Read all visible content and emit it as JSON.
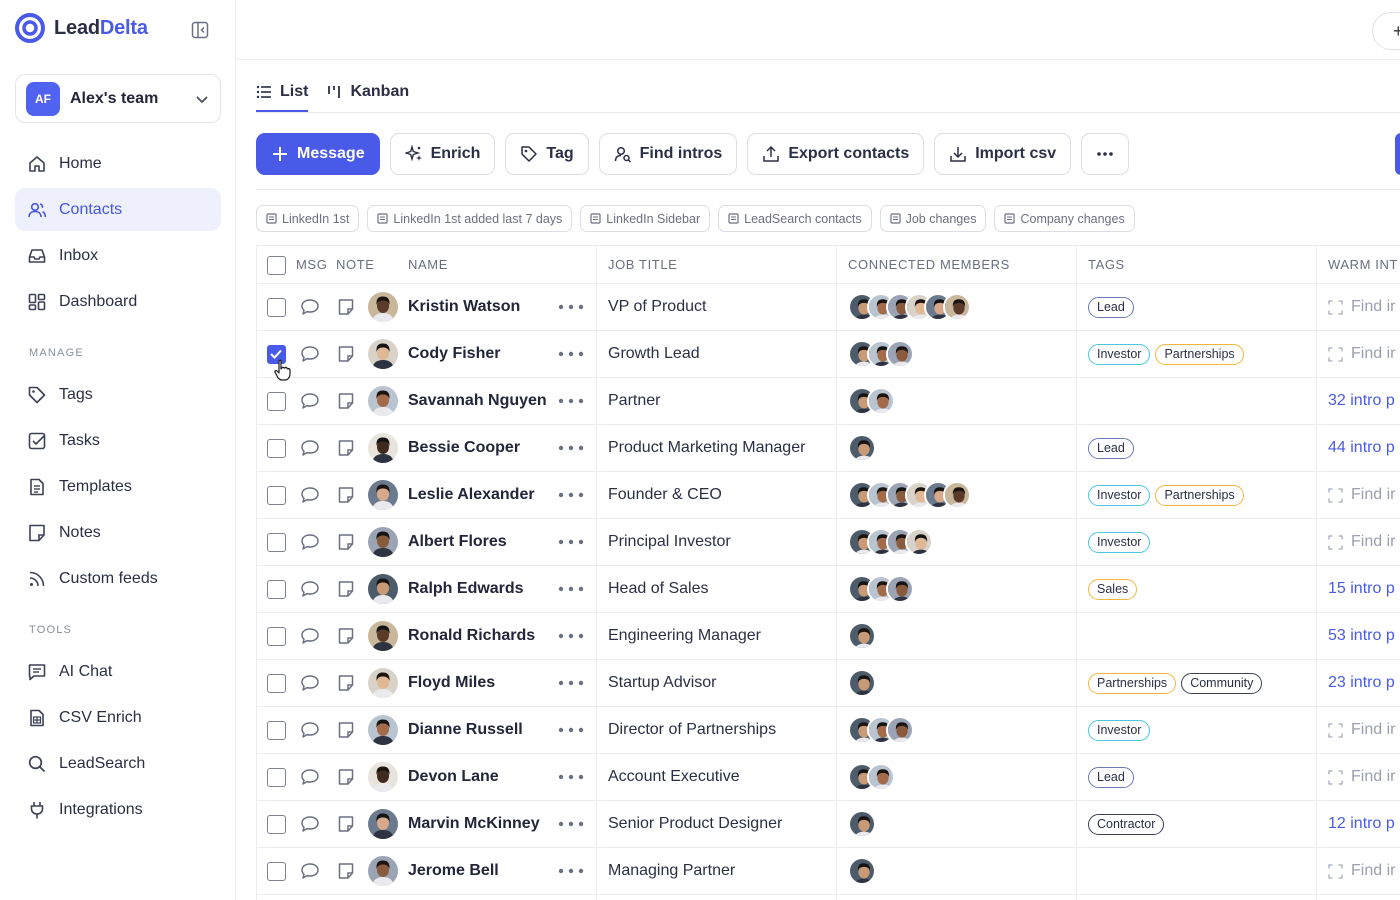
{
  "app": {
    "logo_part1": "Lead",
    "logo_part2": "Delta",
    "brand_color": "#4a5ae8"
  },
  "team": {
    "initials": "AF",
    "name": "Alex's team"
  },
  "sidebar": {
    "main": [
      {
        "label": "Home",
        "icon": "home-icon"
      },
      {
        "label": "Contacts",
        "icon": "contacts-icon",
        "active": true
      },
      {
        "label": "Inbox",
        "icon": "inbox-icon"
      },
      {
        "label": "Dashboard",
        "icon": "dashboard-icon"
      }
    ],
    "manage_title": "MANAGE",
    "manage": [
      {
        "label": "Tags",
        "icon": "tag-icon"
      },
      {
        "label": "Tasks",
        "icon": "task-icon"
      },
      {
        "label": "Templates",
        "icon": "template-icon"
      },
      {
        "label": "Notes",
        "icon": "note-icon"
      },
      {
        "label": "Custom feeds",
        "icon": "rss-icon"
      }
    ],
    "tools_title": "TOOLS",
    "tools": [
      {
        "label": "AI Chat",
        "icon": "chat-icon"
      },
      {
        "label": "CSV Enrich",
        "icon": "csv-icon"
      },
      {
        "label": "LeadSearch",
        "icon": "search-icon"
      },
      {
        "label": "Integrations",
        "icon": "plug-icon"
      }
    ]
  },
  "views": {
    "list": "List",
    "kanban": "Kanban"
  },
  "actions": {
    "message": "Message",
    "enrich": "Enrich",
    "tag": "Tag",
    "find_intros": "Find intros",
    "export": "Export contacts",
    "import": "Import csv"
  },
  "filters": [
    "LinkedIn 1st",
    "LinkedIn 1st added last 7 days",
    "LinkedIn Sidebar",
    "LeadSearch contacts",
    "Job changes",
    "Company changes"
  ],
  "table": {
    "headers": {
      "msg": "MSG",
      "note": "NOTE",
      "name": "NAME",
      "job": "JOB TITLE",
      "connected": "CONNECTED MEMBERS",
      "tags": "TAGS",
      "warm": "WARM INT"
    },
    "find_label": "Find ir",
    "rows": [
      {
        "name": "Kristin Watson",
        "job": "VP of Product",
        "members": 6,
        "tags": [
          "Lead"
        ],
        "warm": "",
        "checked": false
      },
      {
        "name": "Cody Fisher",
        "job": "Growth Lead",
        "members": 3,
        "tags": [
          "Investor",
          "Partnerships"
        ],
        "warm": "",
        "checked": true
      },
      {
        "name": "Savannah Nguyen",
        "job": "Partner",
        "members": 2,
        "tags": [],
        "warm": "32 intro p",
        "checked": false
      },
      {
        "name": "Bessie Cooper",
        "job": "Product Marketing Manager",
        "members": 1,
        "tags": [
          "Lead"
        ],
        "warm": "44 intro p",
        "checked": false
      },
      {
        "name": "Leslie Alexander",
        "job": "Founder & CEO",
        "members": 6,
        "tags": [
          "Investor",
          "Partnerships"
        ],
        "warm": "",
        "checked": false
      },
      {
        "name": "Albert Flores",
        "job": "Principal Investor",
        "members": 4,
        "tags": [
          "Investor"
        ],
        "warm": "",
        "checked": false
      },
      {
        "name": "Ralph Edwards",
        "job": "Head of Sales",
        "members": 3,
        "tags": [
          "Sales"
        ],
        "warm": "15 intro p",
        "checked": false
      },
      {
        "name": "Ronald Richards",
        "job": "Engineering Manager",
        "members": 1,
        "tags": [],
        "warm": "53 intro p",
        "checked": false
      },
      {
        "name": "Floyd Miles",
        "job": "Startup Advisor",
        "members": 1,
        "tags": [
          "Partnerships",
          "Community"
        ],
        "warm": "23 intro p",
        "checked": false
      },
      {
        "name": "Dianne Russell",
        "job": "Director of Partnerships",
        "members": 3,
        "tags": [
          "Investor"
        ],
        "warm": "",
        "checked": false
      },
      {
        "name": "Devon Lane",
        "job": "Account Executive",
        "members": 2,
        "tags": [
          "Lead"
        ],
        "warm": "",
        "checked": false
      },
      {
        "name": "Marvin McKinney",
        "job": "Senior Product Designer",
        "members": 1,
        "tags": [
          "Contractor"
        ],
        "warm": "12 intro p",
        "checked": false
      },
      {
        "name": "Jerome Bell",
        "job": "Managing Partner",
        "members": 1,
        "tags": [],
        "warm": "",
        "checked": false
      }
    ]
  }
}
